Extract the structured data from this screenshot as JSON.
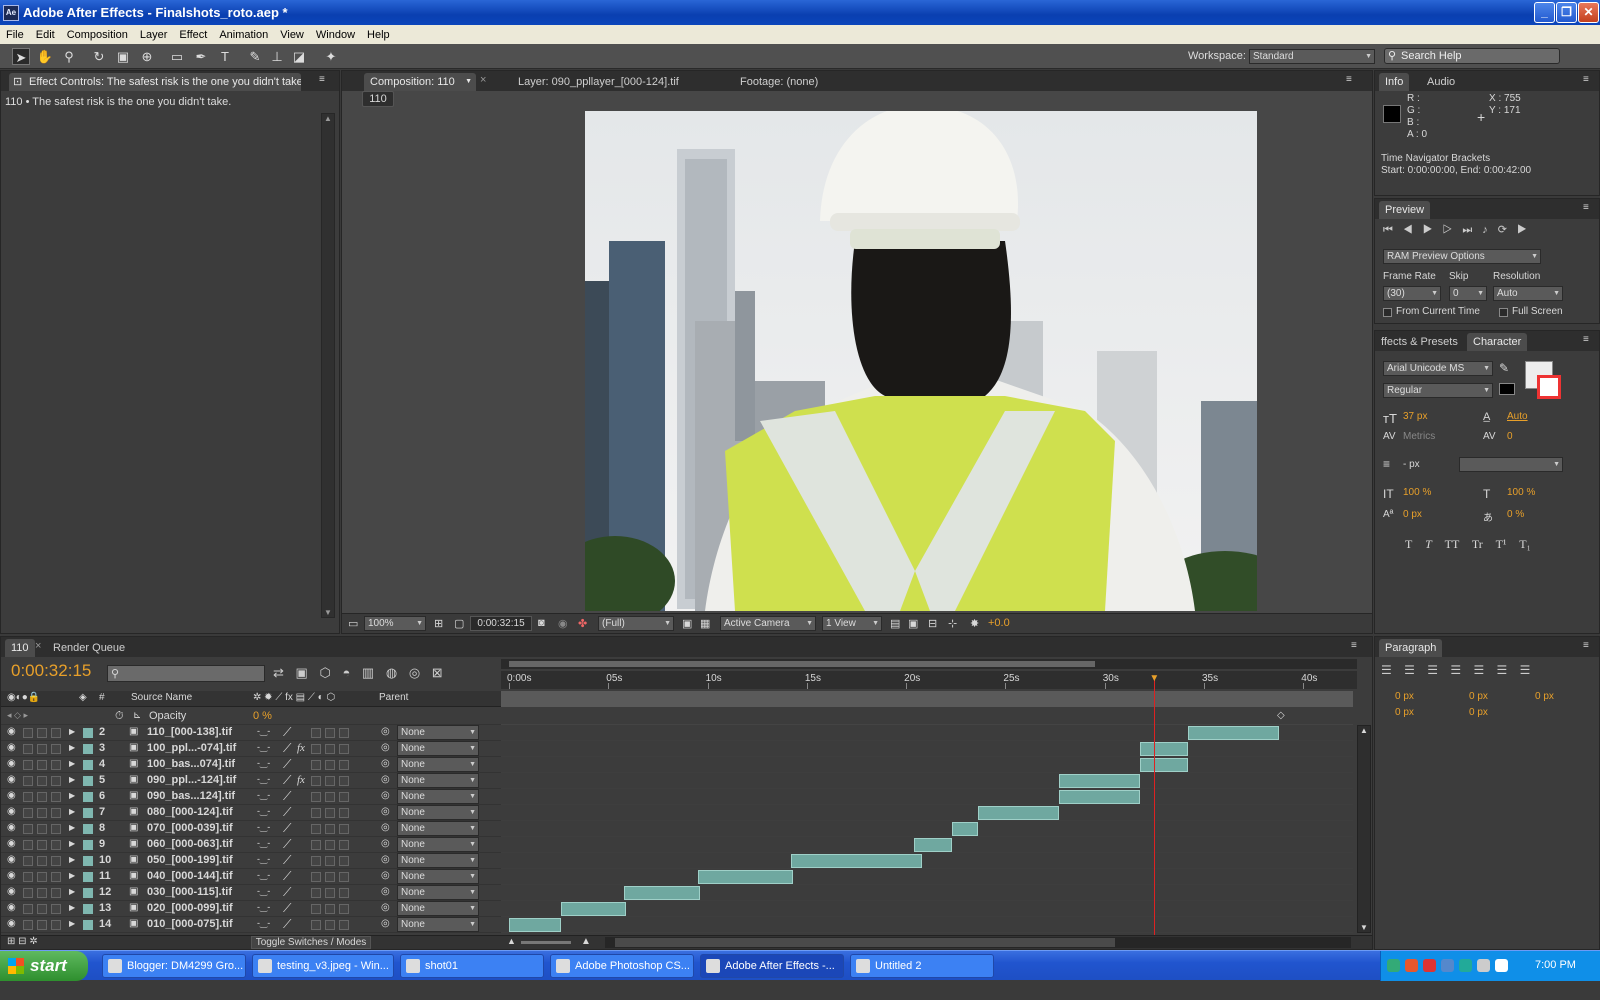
{
  "window": {
    "title": "Adobe After Effects - Finalshots_roto.aep *",
    "app_icon": "Ae"
  },
  "menu": [
    "File",
    "Edit",
    "Composition",
    "Layer",
    "Effect",
    "Animation",
    "View",
    "Window",
    "Help"
  ],
  "toolbar": {
    "workspace_label": "Workspace:",
    "workspace_value": "Standard",
    "search_help": "Search Help"
  },
  "effect_controls": {
    "tab": "Effect Controls: The safest risk is the one you didn't take.",
    "subtitle": "110 • The safest risk is the one you didn't take."
  },
  "viewer": {
    "tabs": [
      "Composition: 110",
      "Layer: 090_ppllayer_[000-124].tif",
      "Footage: (none)"
    ],
    "comp_label": "110",
    "zoom": "100%",
    "timecode": "0:00:32:15",
    "resolution": "(Full)",
    "camera": "Active Camera",
    "views": "1 View",
    "exposure": "+0.0"
  },
  "info": {
    "tabs": [
      "Info",
      "Audio"
    ],
    "r": "R :",
    "g": "G :",
    "b": "B :",
    "a": "A : 0",
    "x": "X : 755",
    "y": "Y : 171",
    "bracket_title": "Time Navigator Brackets",
    "bracket_range": "Start: 0:00:00:00, End: 0:00:42:00"
  },
  "preview": {
    "tab": "Preview",
    "ram": "RAM Preview Options",
    "frame_rate_label": "Frame Rate",
    "skip_label": "Skip",
    "resolution_label": "Resolution",
    "frame_rate": "(30)",
    "skip": "0",
    "resolution": "Auto",
    "from_current": "From Current Time",
    "full_screen": "Full Screen"
  },
  "character": {
    "tabs": [
      "ffects & Presets",
      "Character"
    ],
    "font": "Arial Unicode MS",
    "style": "Regular",
    "size": "37 px",
    "leading": "Auto",
    "kerning": "Metrics",
    "tracking": "0",
    "stroke": "- px",
    "vscale": "100 %",
    "hscale": "100 %",
    "baseline": "0 px",
    "tsume": "0 %",
    "styles": [
      "T",
      "T",
      "TT",
      "Tr",
      "T¹",
      "T₁"
    ]
  },
  "paragraph": {
    "tab": "Paragraph",
    "values": [
      "0 px",
      "0 px",
      "0 px",
      "0 px",
      "0 px"
    ]
  },
  "timeline": {
    "tabs": [
      "110",
      "Render Queue"
    ],
    "timecode": "0:00:32:15",
    "columns": {
      "num": "#",
      "source": "Source Name",
      "parent": "Parent"
    },
    "opacity_label": "Opacity",
    "opacity_value": "0 %",
    "ruler": [
      "0:00s",
      "05s",
      "10s",
      "15s",
      "20s",
      "25s",
      "30s",
      "35s",
      "40s"
    ],
    "toggle": "Toggle Switches / Modes",
    "layers": [
      {
        "n": "2",
        "name": "110_[000-138].tif",
        "fx": false,
        "parent": "None",
        "start": 34.2,
        "end": 38.8
      },
      {
        "n": "3",
        "name": "100_ppl...-074].tif",
        "fx": true,
        "parent": "None",
        "start": 31.8,
        "end": 34.2
      },
      {
        "n": "4",
        "name": "100_bas...074].tif",
        "fx": false,
        "parent": "None",
        "start": 31.8,
        "end": 34.2
      },
      {
        "n": "5",
        "name": "090_ppl...-124].tif",
        "fx": true,
        "parent": "None",
        "start": 27.7,
        "end": 31.8
      },
      {
        "n": "6",
        "name": "090_bas...124].tif",
        "fx": false,
        "parent": "None",
        "start": 27.7,
        "end": 31.8
      },
      {
        "n": "7",
        "name": "080_[000-124].tif",
        "fx": false,
        "parent": "None",
        "start": 23.6,
        "end": 27.7
      },
      {
        "n": "8",
        "name": "070_[000-039].tif",
        "fx": false,
        "parent": "None",
        "start": 22.3,
        "end": 23.6
      },
      {
        "n": "9",
        "name": "060_[000-063].tif",
        "fx": false,
        "parent": "None",
        "start": 20.4,
        "end": 22.3
      },
      {
        "n": "10",
        "name": "050_[000-199].tif",
        "fx": false,
        "parent": "None",
        "start": 14.2,
        "end": 20.8
      },
      {
        "n": "11",
        "name": "040_[000-144].tif",
        "fx": false,
        "parent": "None",
        "start": 9.5,
        "end": 14.3
      },
      {
        "n": "12",
        "name": "030_[000-115].tif",
        "fx": false,
        "parent": "None",
        "start": 5.8,
        "end": 9.6
      },
      {
        "n": "13",
        "name": "020_[000-099].tif",
        "fx": false,
        "parent": "None",
        "start": 2.6,
        "end": 5.9
      },
      {
        "n": "14",
        "name": "010_[000-075].tif",
        "fx": false,
        "parent": "None",
        "start": 0,
        "end": 2.6
      }
    ],
    "playhead_seconds": 32.5,
    "work_area": [
      0,
      29.5
    ],
    "duration_seconds": 42
  },
  "taskbar": {
    "start": "start",
    "tasks": [
      "Blogger: DM4299 Gro...",
      "testing_v3.jpeg - Win...",
      "shot01",
      "Adobe Photoshop CS...",
      "Adobe After Effects -...",
      "Untitled 2"
    ],
    "active_task": 4,
    "clock": "7:00 PM"
  }
}
